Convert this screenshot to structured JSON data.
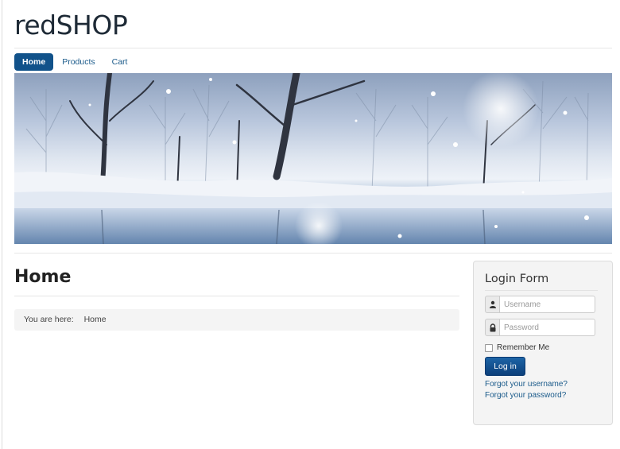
{
  "site": {
    "title": "redSHOP"
  },
  "nav": {
    "items": [
      {
        "label": "Home",
        "active": true
      },
      {
        "label": "Products",
        "active": false
      },
      {
        "label": "Cart",
        "active": false
      }
    ]
  },
  "banner": {
    "scene": "snowy winter forest beside a lake"
  },
  "page": {
    "heading": "Home",
    "breadcrumb": {
      "label": "You are here:",
      "items": [
        "Home"
      ]
    }
  },
  "login": {
    "title": "Login Form",
    "username_placeholder": "Username",
    "password_placeholder": "Password",
    "username_icon": "user-icon",
    "password_icon": "lock-icon",
    "remember_label": "Remember Me",
    "submit_label": "Log in",
    "forgot_username": "Forgot your username?",
    "forgot_password": "Forgot your password?"
  },
  "colors": {
    "accent": "#11528a",
    "link": "#1a5a8a",
    "title": "#1e2a36"
  }
}
